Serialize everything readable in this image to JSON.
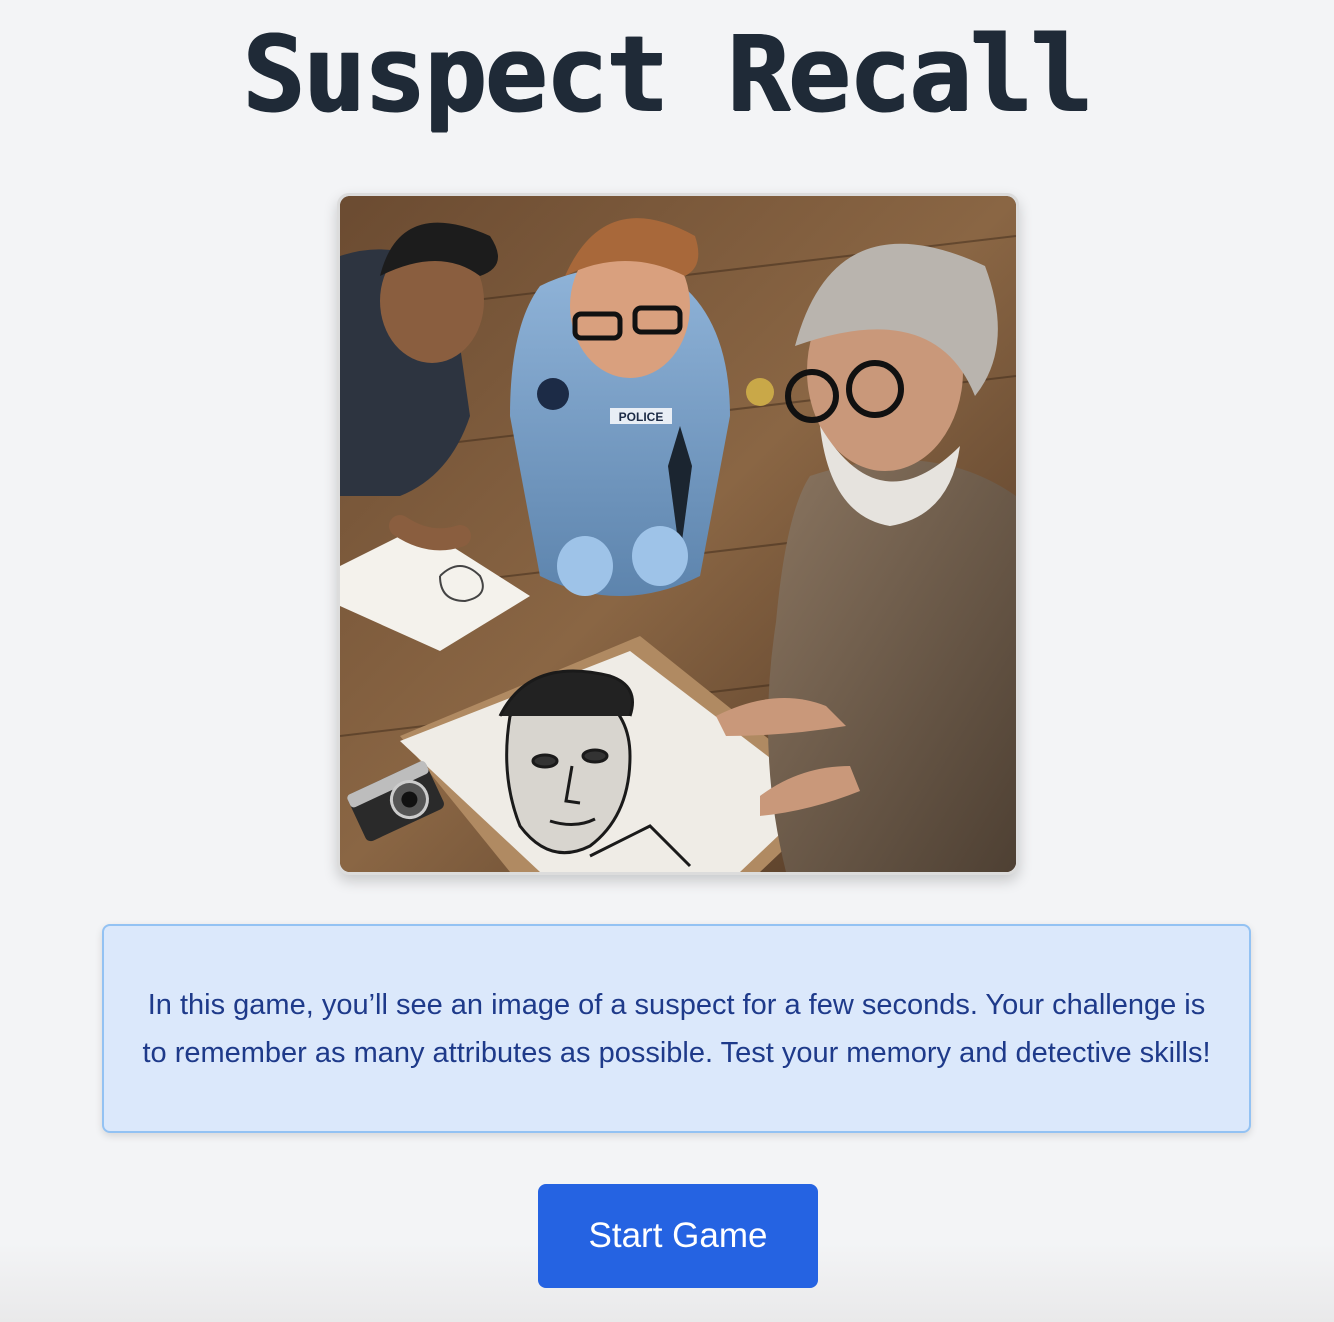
{
  "title": "Suspect Recall",
  "hero_image": {
    "description_icon": "forensic-sketch-illustration"
  },
  "info": {
    "text": "In this game, you’ll see an image of a suspect for a few seconds. Your challenge is to remember as many attributes as possible. Test your memory and detective skills!"
  },
  "start_button": {
    "label": "Start Game"
  },
  "illustration": {
    "badge_text": "POLICE"
  },
  "colors": {
    "background": "#f3f4f6",
    "title": "#1f2a37",
    "info_bg": "#dbe8fb",
    "info_border": "#93c2f3",
    "info_text": "#1e3a8a",
    "button": "#2563e2"
  }
}
